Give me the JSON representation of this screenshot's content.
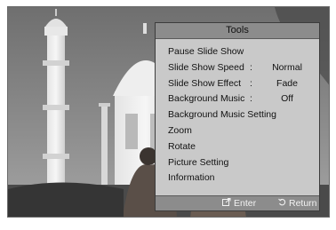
{
  "tools_menu": {
    "title": "Tools",
    "items": [
      {
        "label": "Pause Slide Show",
        "sep": "",
        "value": ""
      },
      {
        "label": "Slide Show Speed",
        "sep": ":",
        "value": "Normal"
      },
      {
        "label": "Slide Show Effect",
        "sep": ":",
        "value": "Fade"
      },
      {
        "label": "Background Music",
        "sep": ":",
        "value": "Off"
      },
      {
        "label": "Background Music Setting",
        "sep": "",
        "value": ""
      },
      {
        "label": "Zoom",
        "sep": "",
        "value": ""
      },
      {
        "label": "Rotate",
        "sep": "",
        "value": ""
      },
      {
        "label": "Picture Setting",
        "sep": "",
        "value": ""
      },
      {
        "label": "Information",
        "sep": "",
        "value": ""
      }
    ],
    "footer": {
      "enter_label": "Enter",
      "enter_icon": "enter-icon",
      "return_label": "Return",
      "return_icon": "return-icon"
    }
  }
}
